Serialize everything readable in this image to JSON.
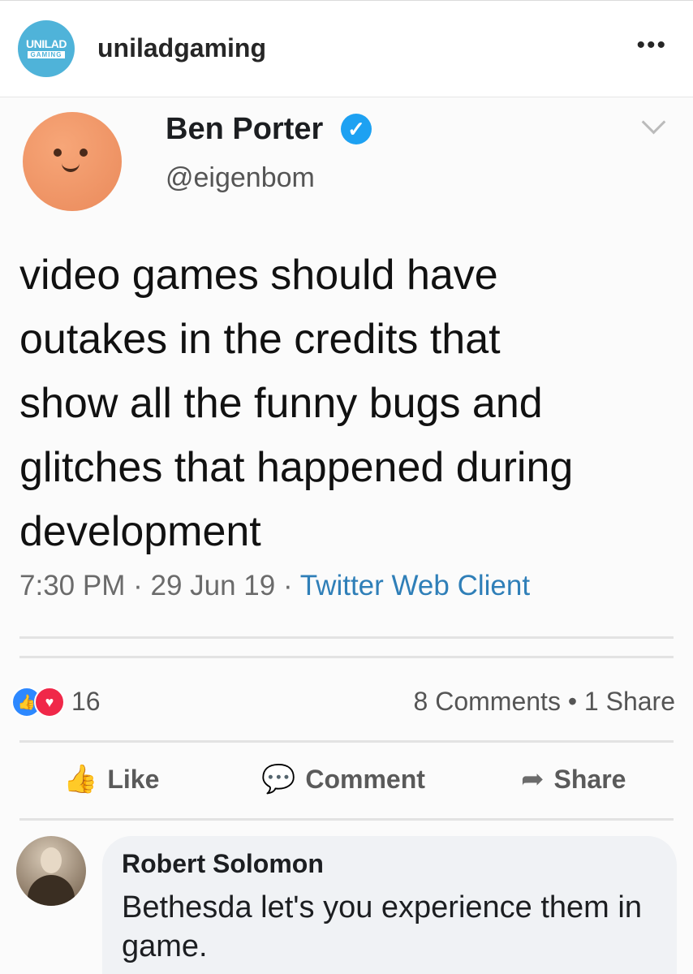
{
  "instagram": {
    "avatar_text_line1": "UNILAD",
    "avatar_text_line2": "GAMING",
    "username": "uniladgaming",
    "more_glyph": "•••"
  },
  "tweet": {
    "author_name": "Ben Porter",
    "handle": "@eigenbom",
    "verified_glyph": "✓",
    "text": "video games should have\noutakes in the credits that\nshow all the funny bugs and\nglitches that happened during\ndevelopment",
    "time": "7:30 PM",
    "date": "29 Jun 19",
    "client": "Twitter Web Client",
    "separator": "·"
  },
  "facebook": {
    "reaction_count": "16",
    "comments_shares": "8 Comments • 1 Share",
    "actions": {
      "like": "Like",
      "comment": "Comment",
      "share": "Share"
    },
    "comment": {
      "author": "Robert Solomon",
      "text": "Bethesda let's you experience them in game."
    }
  },
  "colors": {
    "instagram_avatar": "#4fb3d9",
    "verified": "#1da1f2",
    "link": "#2f7fb8",
    "like_reaction": "#2d88ff",
    "love_reaction": "#f02849",
    "comment_bubble": "#f0f2f5"
  }
}
